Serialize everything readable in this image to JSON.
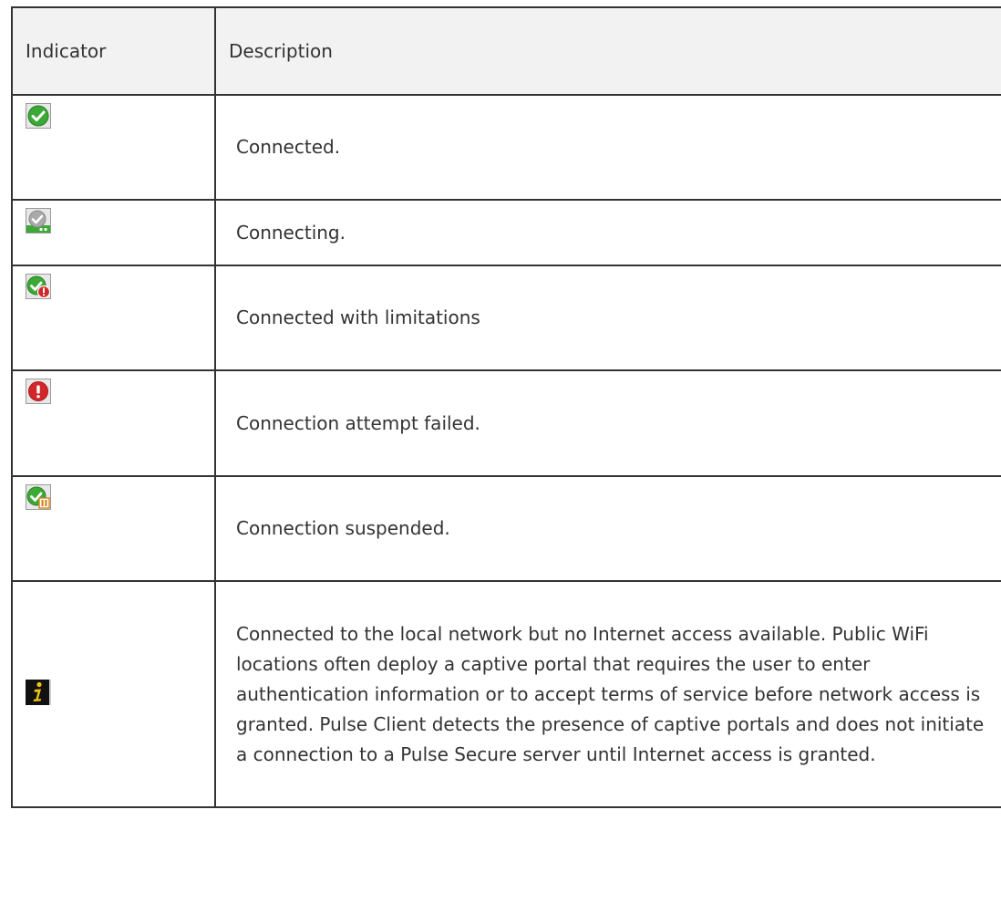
{
  "header": {
    "indicator": "Indicator",
    "description": "Description"
  },
  "rows": [
    {
      "icon": "connected-check-icon",
      "description": "Connected."
    },
    {
      "icon": "connecting-icon",
      "description": "Connecting."
    },
    {
      "icon": "connected-limitations-icon",
      "description": "Connected with limitations"
    },
    {
      "icon": "connection-failed-icon",
      "description": "Connection attempt failed."
    },
    {
      "icon": "connection-suspended-icon",
      "description": "Connection suspended."
    },
    {
      "icon": "captive-portal-info-icon",
      "description": "Connected to the local network but no Internet access available. Public WiFi locations often deploy a captive portal that requires the user to enter authentication information or to accept terms of service before network access is granted. Pulse Client detects the presence of captive portals and does not initiate a connection to a Pulse Secure server until Internet access is granted."
    }
  ],
  "colors": {
    "green": "#3aa935",
    "red": "#d2262a",
    "gray": "#9a9a9a",
    "orange": "#d9821e",
    "info_bg": "#111111",
    "info_fg": "#f2c417"
  }
}
